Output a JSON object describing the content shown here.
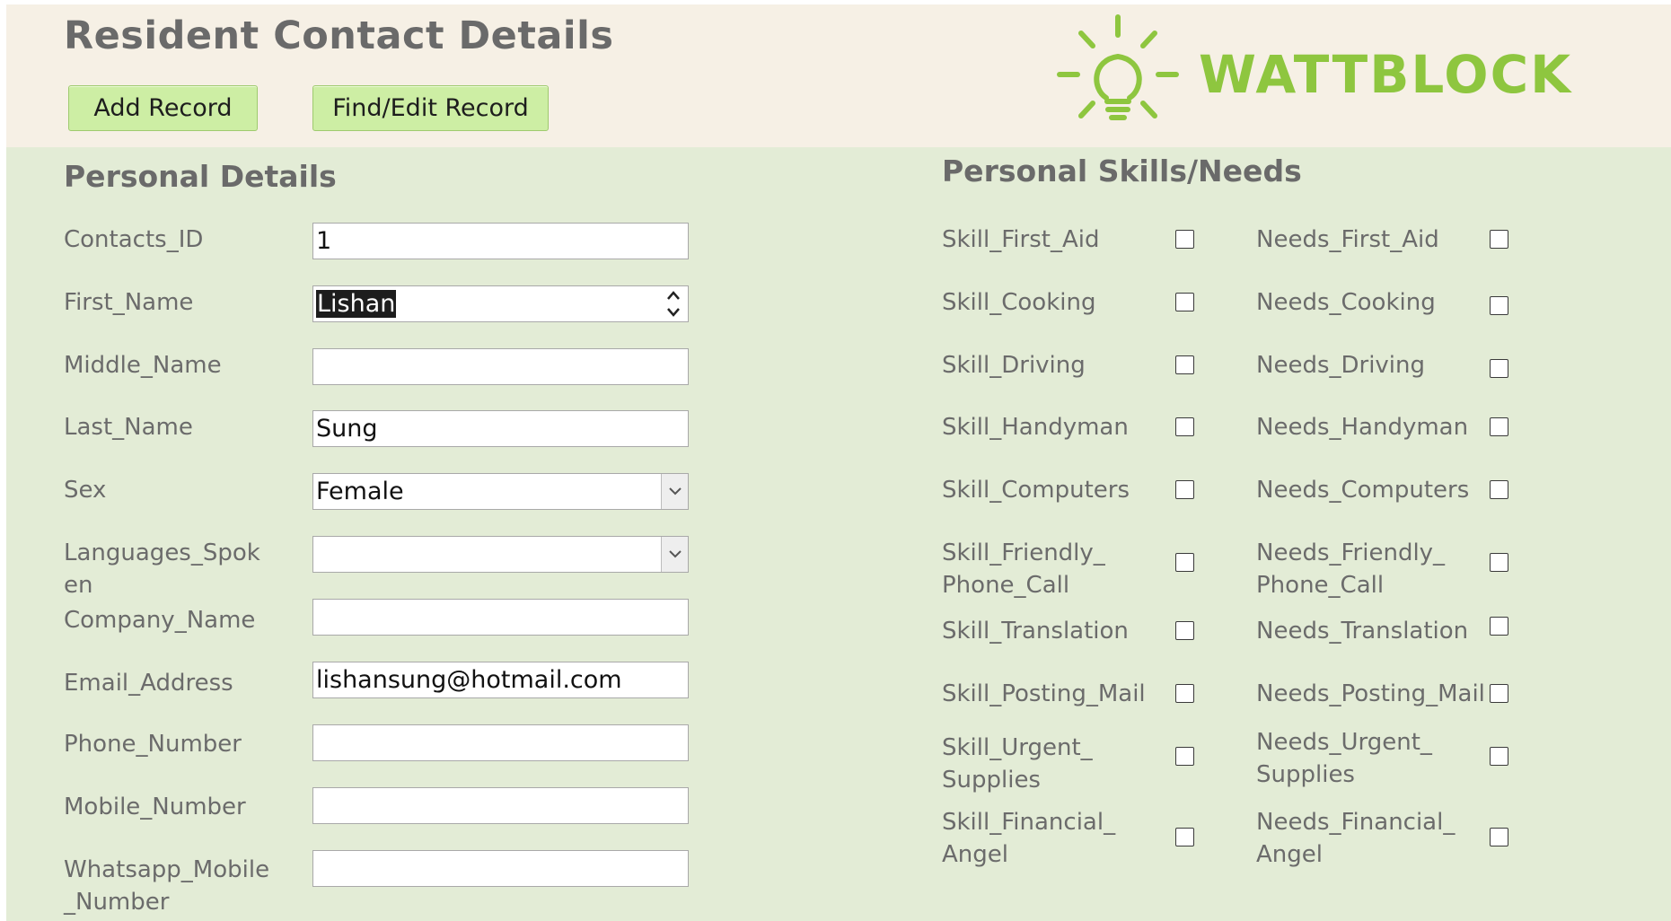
{
  "header": {
    "title": "Resident Contact Details",
    "add_button": "Add Record",
    "find_button": "Find/Edit Record",
    "logo_text": "WATTBLOCK",
    "logo_color": "#8ec63f"
  },
  "personal": {
    "section_title": "Personal Details",
    "fields": [
      {
        "label": "Contacts_ID",
        "value": "1"
      },
      {
        "label": "First_Name",
        "value": "Lishan"
      },
      {
        "label": "Middle_Name",
        "value": ""
      },
      {
        "label": "Last_Name",
        "value": "Sung"
      },
      {
        "label": "Sex",
        "value": "Female"
      },
      {
        "label": "Languages_Spoken",
        "value": ""
      },
      {
        "label": "Company_Name",
        "value": ""
      },
      {
        "label": "Email_Address",
        "value": "lishansung@hotmail.com"
      },
      {
        "label": "Phone_Number",
        "value": ""
      },
      {
        "label": "Mobile_Number",
        "value": ""
      },
      {
        "label": "Whatsapp_Mobile_Number",
        "value": ""
      }
    ]
  },
  "skills": {
    "section_title": "Personal Skills/Needs",
    "skill_labels": [
      "Skill_First_Aid",
      "Skill_Cooking",
      "Skill_Driving",
      "Skill_Handyman",
      "Skill_Computers",
      "Skill_Friendly_ Phone_Call",
      "Skill_Translation",
      "Skill_Posting_Mail",
      "Skill_Urgent_ Supplies",
      "Skill_Financial_ Angel"
    ],
    "needs_labels": [
      "Needs_First_Aid",
      "Needs_Cooking",
      "Needs_Driving",
      "Needs_Handyman",
      "Needs_Computers",
      "Needs_Friendly_ Phone_Call",
      "Needs_Translation",
      "Needs_Posting_Mail",
      "Needs_Urgent_ Supplies",
      "Needs_Financial_ Angel"
    ]
  },
  "icons": {
    "logo": "lightbulb-icon",
    "dropdown": "chevron-down-icon",
    "spinner": "up-down-arrows-icon"
  }
}
